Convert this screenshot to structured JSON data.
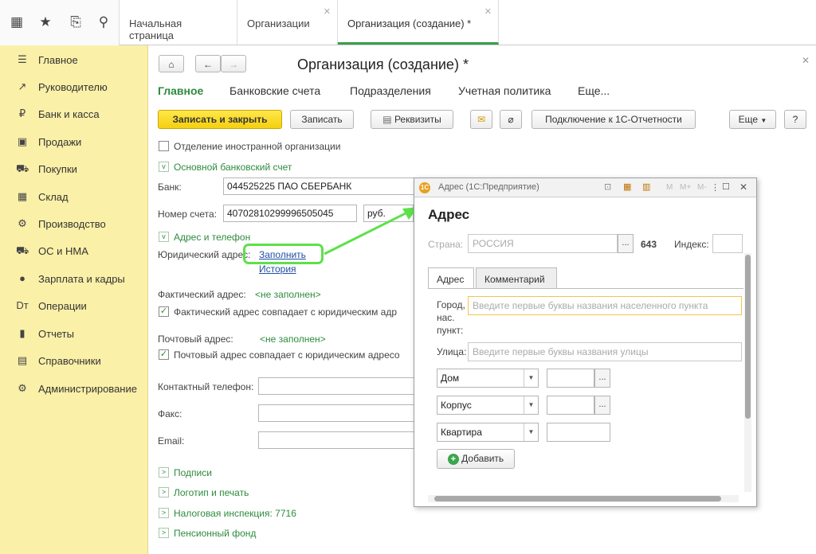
{
  "topbar": {
    "tabs": [
      {
        "label": "Начальная страница"
      },
      {
        "label": "Организации"
      },
      {
        "label": "Организация (создание) *"
      }
    ]
  },
  "sidebar": {
    "items": [
      {
        "label": "Главное",
        "icon": "menu-icon"
      },
      {
        "label": "Руководителю",
        "icon": "chart-trend-icon"
      },
      {
        "label": "Банк и касса",
        "icon": "ruble-icon"
      },
      {
        "label": "Продажи",
        "icon": "bag-icon"
      },
      {
        "label": "Покупки",
        "icon": "cart-icon"
      },
      {
        "label": "Склад",
        "icon": "grid-icon"
      },
      {
        "label": "Производство",
        "icon": "factory-icon"
      },
      {
        "label": "ОС и НМА",
        "icon": "truck-icon"
      },
      {
        "label": "Зарплата и кадры",
        "icon": "person-icon"
      },
      {
        "label": "Операции",
        "icon": "operations-icon"
      },
      {
        "label": "Отчеты",
        "icon": "bar-chart-icon"
      },
      {
        "label": "Справочники",
        "icon": "book-icon"
      },
      {
        "label": "Администрирование",
        "icon": "gear-icon"
      }
    ]
  },
  "main": {
    "title": "Организация (создание) *",
    "tabs": [
      "Главное",
      "Банковские счета",
      "Подразделения",
      "Учетная политика",
      "Еще..."
    ],
    "toolbar": {
      "save_close": "Записать и закрыть",
      "save": "Записать",
      "requisites": "Реквизиты",
      "connect": "Подключение к 1С-Отчетности",
      "more": "Еще",
      "help": "?"
    },
    "foreign_branch": "Отделение иностранной организации",
    "bank_section": "Основной банковский счет",
    "bank_label": "Банк:",
    "bank_value": "044525225 ПАО СБЕРБАНК",
    "account_label": "Номер счета:",
    "account_value": "40702810299996505045",
    "currency_value": "руб.",
    "address_section": "Адрес и телефон",
    "legal_address_label": "Юридический адрес:",
    "fill_link": "Заполнить",
    "history_link": "История",
    "actual_address_label": "Фактический адрес:",
    "actual_address_value": "<не заполнен>",
    "actual_same": "Фактический адрес совпадает с юридическим адр",
    "postal_address_label": "Почтовый адрес:",
    "postal_address_value": "<не заполнен>",
    "postal_same": "Почтовый адрес совпадает с юридическим адресо",
    "phone_label": "Контактный телефон:",
    "fax_label": "Факс:",
    "email_label": "Email:",
    "sections": [
      "Подписи",
      "Логотип и печать",
      "Налоговая инспекция: 7716",
      "Пенсионный фонд"
    ]
  },
  "dialog": {
    "window_title": "Адрес (1С:Предприятие)",
    "heading": "Адрес",
    "country_label": "Страна:",
    "country_value": "РОССИЯ",
    "country_code": "643",
    "index_label": "Индекс:",
    "tabs": [
      "Адрес",
      "Комментарий"
    ],
    "city_label": "Город, нас. пункт:",
    "city_placeholder": "Введите первые буквы названия населенного пункта",
    "street_label": "Улица:",
    "street_placeholder": "Введите первые буквы названия улицы",
    "house": "Дом",
    "building": "Корпус",
    "apartment": "Квартира",
    "add_button": "Добавить",
    "title_buttons": [
      "M",
      "M+",
      "M-"
    ]
  }
}
